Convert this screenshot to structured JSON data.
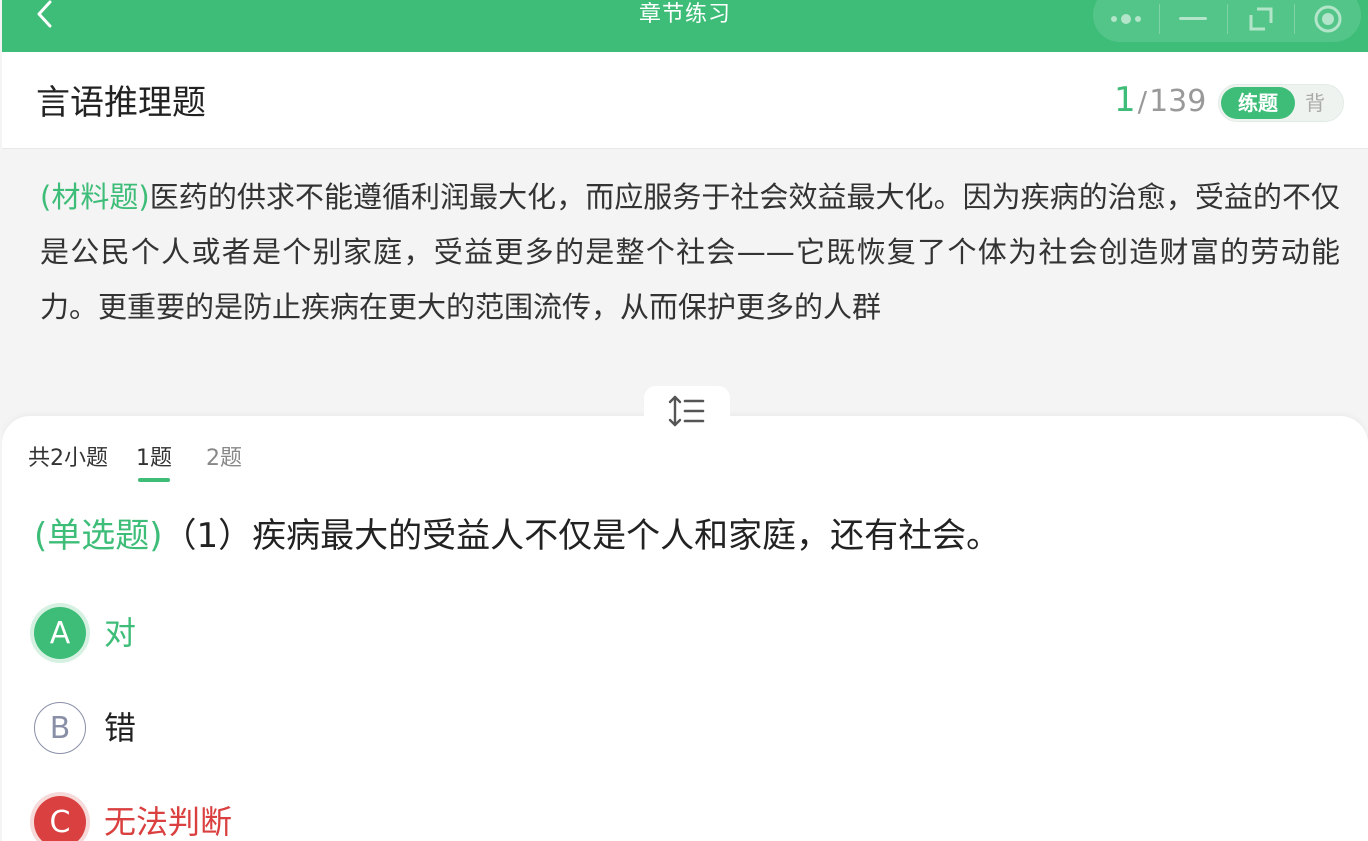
{
  "topbar": {
    "title": "章节练习"
  },
  "header": {
    "title": "言语推理题",
    "progress_current": "1",
    "progress_separator": "/",
    "progress_total": "139",
    "mode_active": "练题",
    "mode_inactive": "背"
  },
  "material": {
    "tag": "(材料题)",
    "text": "医药的供求不能遵循利润最大化，而应服务于社会效益最大化。因为疾病的治愈，受益的不仅是公民个人或者是个别家庭，受益更多的是整个社会——它既恢复了个体为社会创造财富的劳动能力。更重要的是防止疾病在更大的范围流传，从而保护更多的人群"
  },
  "sub_questions": {
    "count_label": "共2小题",
    "tabs": [
      "1题",
      "2题"
    ],
    "active_index": 0
  },
  "question": {
    "tag": "(单选题)",
    "text": "（1）疾病最大的受益人不仅是个人和家庭，还有社会。"
  },
  "options": [
    {
      "letter": "A",
      "text": "对",
      "state": "correct"
    },
    {
      "letter": "B",
      "text": "错",
      "state": "normal"
    },
    {
      "letter": "C",
      "text": "无法判断",
      "state": "wrong"
    }
  ],
  "colors": {
    "brand": "#3dbd78",
    "wrong": "#d9403f"
  },
  "icons": {
    "back": "chevron-left-icon",
    "more": "more-dots-icon",
    "minimize": "minimize-icon",
    "restore": "restore-window-icon",
    "close": "close-circle-icon",
    "handle": "line-spacing-icon"
  }
}
